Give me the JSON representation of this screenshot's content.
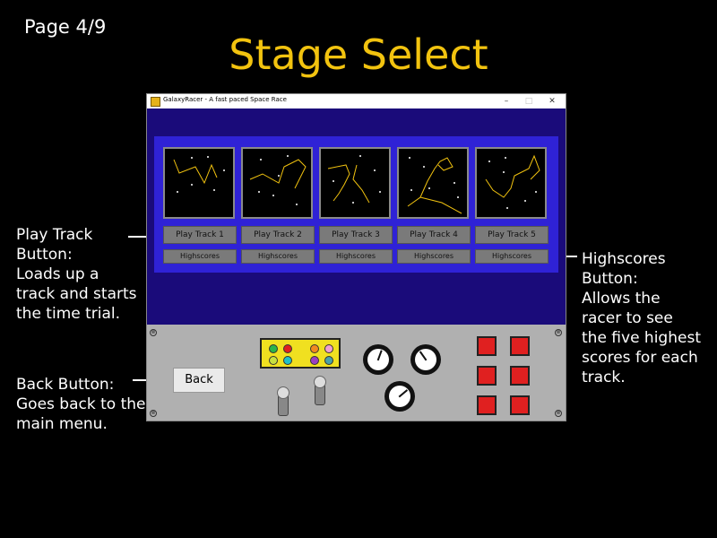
{
  "slide": {
    "page_number": "Page 4/9",
    "title": "Stage Select"
  },
  "annotations": {
    "play_track": "Play Track\nButton:\nLoads up a\ntrack and starts\nthe time trial.",
    "back": "Back Button:\nGoes back to the\nmain menu.",
    "highscores": "Highscores\nButton:\nAllows the\nracer to see\nthe five highest\nscores for each\ntrack."
  },
  "window": {
    "title": "GalaxyRacer - A fast paced Space Race",
    "minimize": "–",
    "maximize": "□",
    "close": "✕"
  },
  "tracks": [
    {
      "play_label": "Play Track 1",
      "highscores_label": "Highscores"
    },
    {
      "play_label": "Play Track 2",
      "highscores_label": "Highscores"
    },
    {
      "play_label": "Play Track 3",
      "highscores_label": "Highscores"
    },
    {
      "play_label": "Play Track 4",
      "highscores_label": "Highscores"
    },
    {
      "play_label": "Play Track 5",
      "highscores_label": "Highscores"
    }
  ],
  "console": {
    "back_label": "Back",
    "screw_glyph": "⊗"
  },
  "colors": {
    "title": "#f2c30f",
    "window_bg": "#1a0b7a",
    "panel": "#2f22d6",
    "track_line": "#f2c30f",
    "console": "#b0b0b0",
    "red_buttons": "#e02020"
  }
}
